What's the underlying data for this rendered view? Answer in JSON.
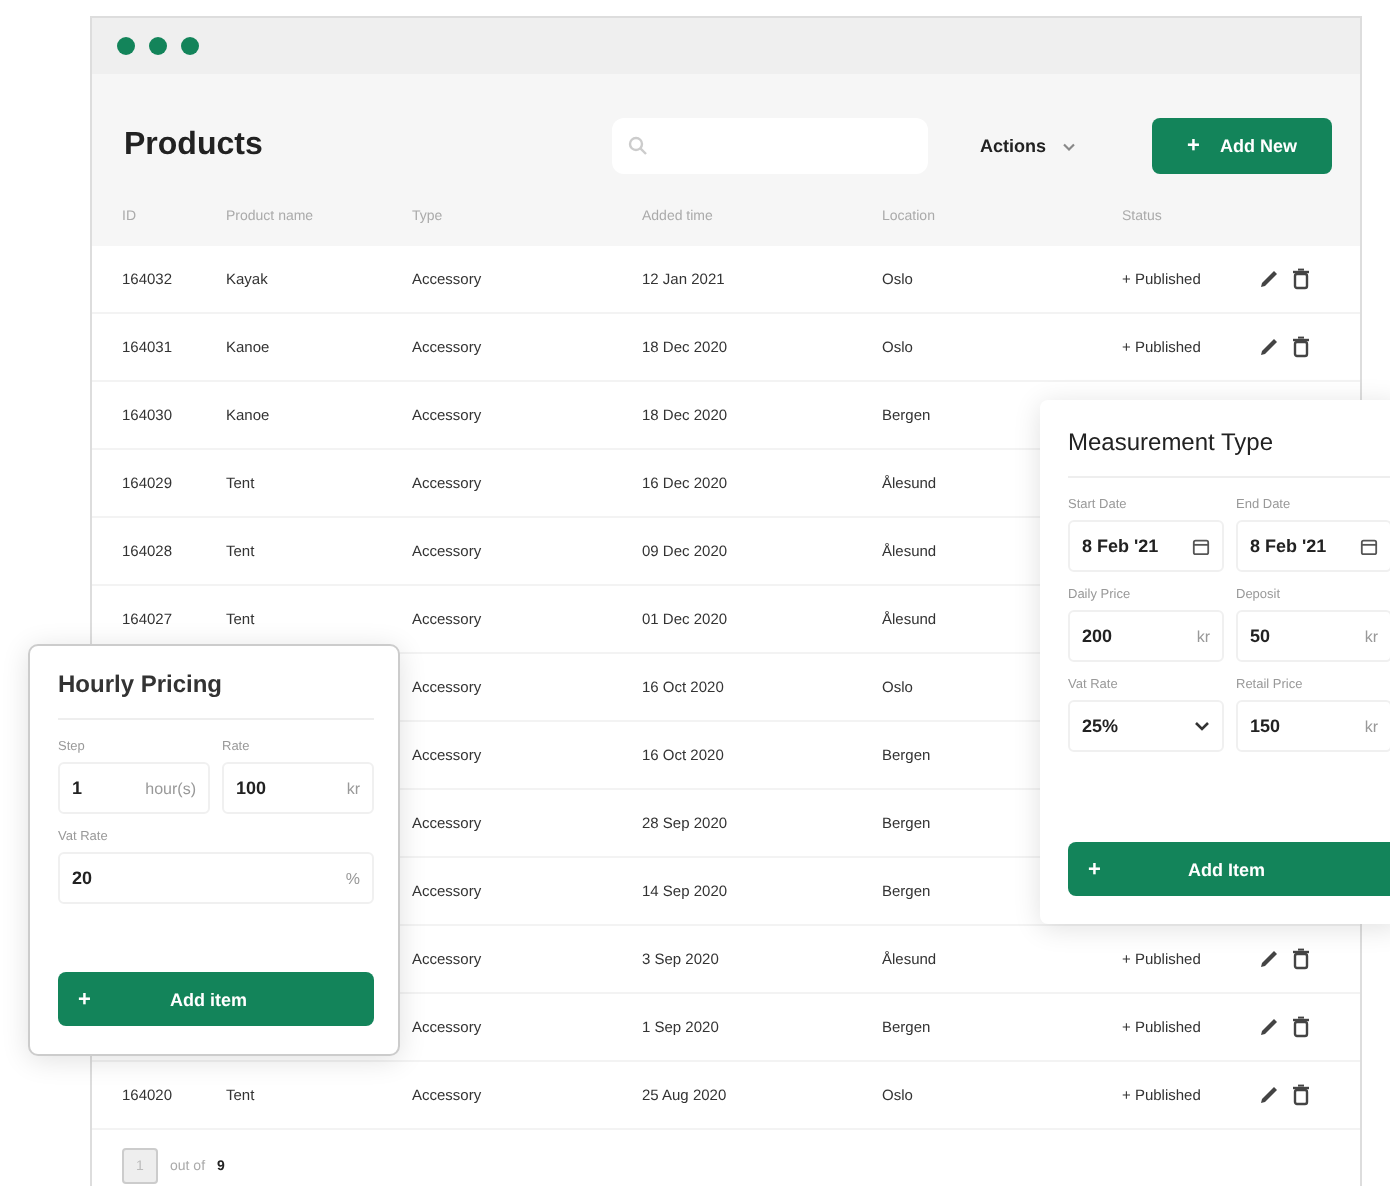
{
  "window": {
    "title": "Products"
  },
  "actions": {
    "label": "Actions"
  },
  "add_button": {
    "icon": "+",
    "label": "Add New"
  },
  "table": {
    "columns": [
      "ID",
      "Product name",
      "Type",
      "Added time",
      "Location",
      "Status"
    ],
    "rows": [
      {
        "id": "164032",
        "name": "Kayak",
        "type": "Accessory",
        "added": "12 Jan 2021",
        "location": "Oslo",
        "status": "+ Published"
      },
      {
        "id": "164031",
        "name": "Kanoe",
        "type": "Accessory",
        "added": "18 Dec 2020",
        "location": "Oslo",
        "status": "+ Published"
      },
      {
        "id": "164030",
        "name": "Kanoe",
        "type": "Accessory",
        "added": "18 Dec 2020",
        "location": "Bergen"
      },
      {
        "id": "164029",
        "name": "Tent",
        "type": "Accessory",
        "added": "16 Dec 2020",
        "location": "Ålesund"
      },
      {
        "id": "164028",
        "name": "Tent",
        "type": "Accessory",
        "added": "09 Dec 2020",
        "location": "Ålesund"
      },
      {
        "id": "164027",
        "name": "Tent",
        "type": "Accessory",
        "added": "01 Dec 2020",
        "location": "Ålesund"
      },
      {
        "type": "Accessory",
        "added": "16 Oct 2020",
        "location": "Oslo"
      },
      {
        "type": "Accessory",
        "added": "16 Oct 2020",
        "location": "Bergen"
      },
      {
        "type": "Accessory",
        "added": "28 Sep 2020",
        "location": "Bergen"
      },
      {
        "type": "Accessory",
        "added": "14 Sep 2020",
        "location": "Bergen"
      },
      {
        "type": "Accessory",
        "added": "3 Sep 2020",
        "location": "Ålesund",
        "status": "+ Published"
      },
      {
        "type": "Accessory",
        "added": "1 Sep 2020",
        "location": "Bergen",
        "status": "+ Published"
      },
      {
        "id": "164020",
        "name": "Tent",
        "type": "Accessory",
        "added": "25 Aug 2020",
        "location": "Oslo",
        "status": "+ Published"
      }
    ]
  },
  "pagination": {
    "page": "1",
    "label": "out of",
    "total": "9"
  },
  "hourly_pricing": {
    "title": "Hourly Pricing",
    "fields": [
      {
        "label": "Step",
        "value": "1",
        "unit": "hour(s)",
        "kind": "text"
      },
      {
        "label": "Rate",
        "value": "100",
        "unit": "kr",
        "kind": "text"
      },
      {
        "label": "Vat Rate",
        "value": "20",
        "unit": "%",
        "kind": "text"
      }
    ],
    "button": {
      "icon": "+",
      "label": "Add item"
    }
  },
  "measurement_type": {
    "title": "Measurement Type",
    "fields": [
      {
        "label": "Start Date",
        "value": "8 Feb '21",
        "kind": "date"
      },
      {
        "label": "End Date",
        "value": "8 Feb '21",
        "kind": "date"
      },
      {
        "label": "Daily Price",
        "value": "200",
        "unit": "kr",
        "kind": "text"
      },
      {
        "label": "Deposit",
        "value": "50",
        "unit": "kr",
        "kind": "text"
      },
      {
        "label": "Vat Rate",
        "value": "25%",
        "kind": "select"
      },
      {
        "label": "Retail Price",
        "value": "150",
        "unit": "kr",
        "kind": "text"
      }
    ],
    "button": {
      "icon": "+",
      "label": "Add Item"
    }
  }
}
